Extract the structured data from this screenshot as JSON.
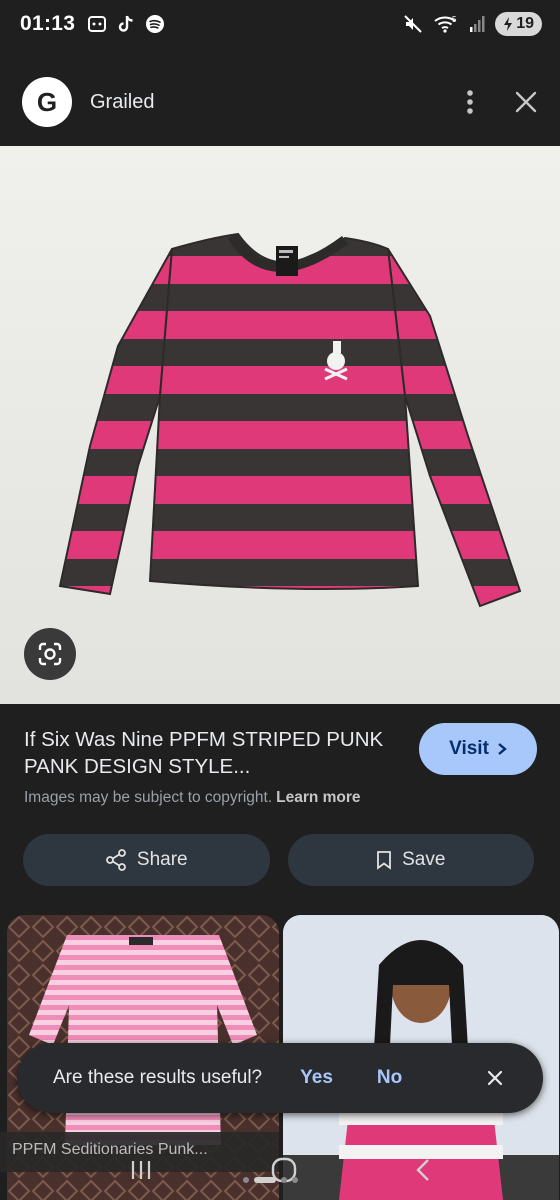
{
  "status_bar": {
    "time": "01:13",
    "battery": "19",
    "network": "5"
  },
  "header": {
    "logo_letter": "G",
    "source": "Grailed"
  },
  "product": {
    "title": "If Six Was Nine PPFM STRIPED PUNK PANK DESIGN STYLE...",
    "visit_label": "Visit",
    "copyright_text": "Images may be subject to copyright.",
    "learn_more_label": "Learn more",
    "share_label": "Share",
    "save_label": "Save"
  },
  "related": [
    {
      "caption": "PPFM Seditionaries Punk..."
    }
  ],
  "feedback": {
    "question": "Are these results useful?",
    "yes_label": "Yes",
    "no_label": "No"
  },
  "colors": {
    "accent": "#a8c7fa",
    "stripe_pink": "#e0397a",
    "stripe_dark": "#3a3535",
    "background": "#1f1f1f"
  }
}
